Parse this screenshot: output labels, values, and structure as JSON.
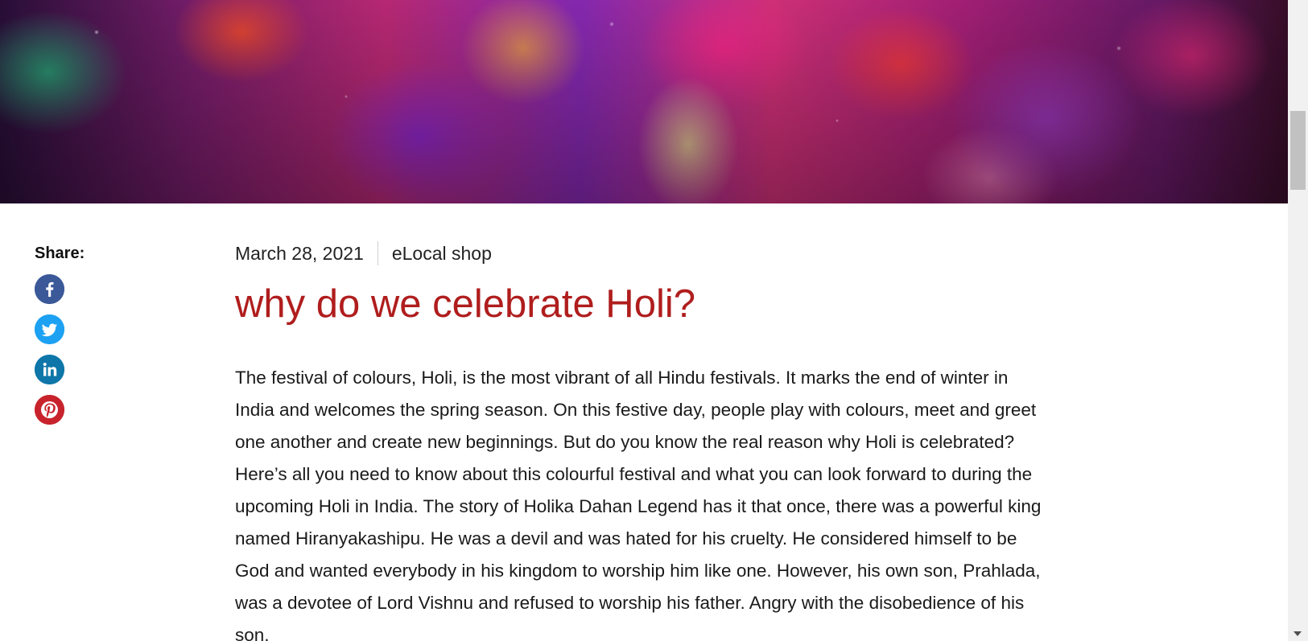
{
  "share": {
    "label": "Share:",
    "buttons": [
      {
        "network": "facebook",
        "icon": "facebook-icon",
        "color": "#3b5998"
      },
      {
        "network": "twitter",
        "icon": "twitter-icon",
        "color": "#1da1f2"
      },
      {
        "network": "linkedin",
        "icon": "linkedin-icon",
        "color": "#0e76a8"
      },
      {
        "network": "pinterest",
        "icon": "pinterest-icon",
        "color": "#c8232c"
      }
    ]
  },
  "article": {
    "date": "March 28, 2021",
    "author": "eLocal shop",
    "title": "why do we celebrate Holi?",
    "title_color": "#b01d1d",
    "body": "The festival of colours, Holi, is the most vibrant of all Hindu festivals. It marks the end of winter in India and welcomes the spring season. On this festive day, people play with colours, meet and greet one another and create new beginnings. But do you know the real reason why Holi is celebrated? Here’s all you need to know about this colourful festival and what you can look forward to during the upcoming Holi in India. The story of Holika Dahan Legend has it that once, there was a powerful king named Hiranyakashipu. He was a devil and was hated for his cruelty. He considered himself to be God and wanted everybody in his kingdom to worship him like one. However, his own son, Prahlada, was a devotee of Lord Vishnu and refused to worship his father. Angry with the disobedience of his son,"
  },
  "hero": {
    "description_icon": "holi-crowd-image"
  }
}
